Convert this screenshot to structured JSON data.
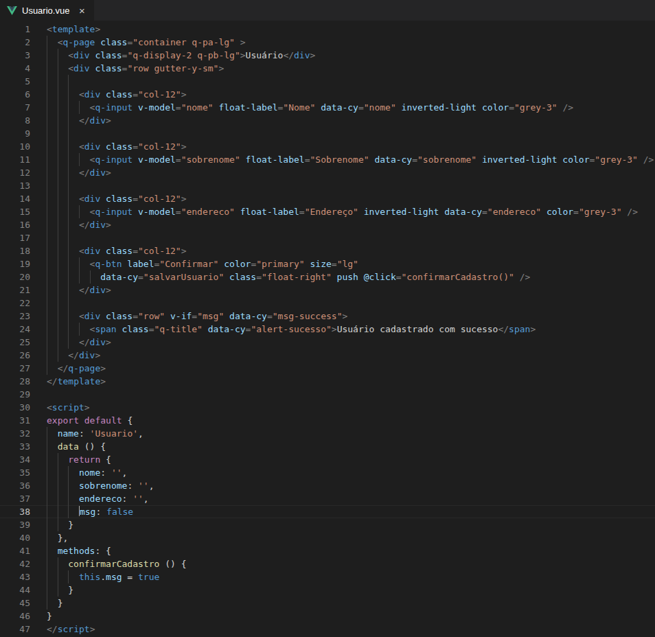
{
  "colors": {
    "editor_bg": "#1e1e1e",
    "tabbar_bg": "#252526",
    "tab_active_bg": "#1e1e1e",
    "tab_title": "#ffffff",
    "tab_close": "#cccccc",
    "line_number": "#858585",
    "line_number_active": "#c6c6c6",
    "indent_guide": "#404040",
    "cursor": "#aeafad",
    "current_line_border": "#282828",
    "tok_punc": "#808080",
    "tok_tag": "#569cd6",
    "tok_attr": "#9cdcfe",
    "tok_string": "#ce9178",
    "tok_text": "#d4d4d4",
    "tok_keyword": "#c586c0",
    "tok_var": "#9cdcfe",
    "tok_func": "#dcdcaa",
    "tok_const": "#569cd6",
    "tok_op": "#d4d4d4",
    "vue_green": "#41b883",
    "vue_dark": "#35495e"
  },
  "tab": {
    "title": "Usuario.vue",
    "close_label": "×"
  },
  "editor": {
    "lines": [
      {
        "n": 1,
        "ind": 0,
        "tokens": [
          [
            "p",
            "<"
          ],
          [
            "t",
            "template"
          ],
          [
            "p",
            ">"
          ]
        ]
      },
      {
        "n": 2,
        "ind": 1,
        "tokens": [
          [
            "p",
            "<"
          ],
          [
            "t",
            "q-page"
          ],
          [
            "a",
            " class"
          ],
          [
            "p",
            "="
          ],
          [
            "s",
            "\"container q-pa-lg\""
          ],
          [
            "p",
            " >"
          ]
        ]
      },
      {
        "n": 3,
        "ind": 2,
        "tokens": [
          [
            "p",
            "<"
          ],
          [
            "t",
            "div"
          ],
          [
            "a",
            " class"
          ],
          [
            "p",
            "="
          ],
          [
            "s",
            "\"q-display-2 q-pb-lg\""
          ],
          [
            "p",
            ">"
          ],
          [
            "x",
            "Usuário"
          ],
          [
            "p",
            "</"
          ],
          [
            "t",
            "div"
          ],
          [
            "p",
            ">"
          ]
        ]
      },
      {
        "n": 4,
        "ind": 2,
        "tokens": [
          [
            "p",
            "<"
          ],
          [
            "t",
            "div"
          ],
          [
            "a",
            " class"
          ],
          [
            "p",
            "="
          ],
          [
            "s",
            "\"row gutter-y-sm\""
          ],
          [
            "p",
            ">"
          ]
        ]
      },
      {
        "n": 5,
        "ind": 3,
        "tokens": []
      },
      {
        "n": 6,
        "ind": 3,
        "tokens": [
          [
            "p",
            "<"
          ],
          [
            "t",
            "div"
          ],
          [
            "a",
            " class"
          ],
          [
            "p",
            "="
          ],
          [
            "s",
            "\"col-12\""
          ],
          [
            "p",
            ">"
          ]
        ]
      },
      {
        "n": 7,
        "ind": 4,
        "tokens": [
          [
            "p",
            "<"
          ],
          [
            "t",
            "q-input"
          ],
          [
            "a",
            " v-model"
          ],
          [
            "p",
            "="
          ],
          [
            "s",
            "\"nome\""
          ],
          [
            "a",
            " float-label"
          ],
          [
            "p",
            "="
          ],
          [
            "s",
            "\"Nome\""
          ],
          [
            "a",
            " data-cy"
          ],
          [
            "p",
            "="
          ],
          [
            "s",
            "\"nome\""
          ],
          [
            "a",
            " inverted-light"
          ],
          [
            "a",
            " color"
          ],
          [
            "p",
            "="
          ],
          [
            "s",
            "\"grey-3\""
          ],
          [
            "p",
            " />"
          ]
        ]
      },
      {
        "n": 8,
        "ind": 3,
        "tokens": [
          [
            "p",
            "</"
          ],
          [
            "t",
            "div"
          ],
          [
            "p",
            ">"
          ]
        ]
      },
      {
        "n": 9,
        "ind": 3,
        "tokens": []
      },
      {
        "n": 10,
        "ind": 3,
        "tokens": [
          [
            "p",
            "<"
          ],
          [
            "t",
            "div"
          ],
          [
            "a",
            " class"
          ],
          [
            "p",
            "="
          ],
          [
            "s",
            "\"col-12\""
          ],
          [
            "p",
            ">"
          ]
        ]
      },
      {
        "n": 11,
        "ind": 4,
        "tokens": [
          [
            "p",
            "<"
          ],
          [
            "t",
            "q-input"
          ],
          [
            "a",
            " v-model"
          ],
          [
            "p",
            "="
          ],
          [
            "s",
            "\"sobrenome\""
          ],
          [
            "a",
            " float-label"
          ],
          [
            "p",
            "="
          ],
          [
            "s",
            "\"Sobrenome\""
          ],
          [
            "a",
            " data-cy"
          ],
          [
            "p",
            "="
          ],
          [
            "s",
            "\"sobrenome\""
          ],
          [
            "a",
            " inverted-light"
          ],
          [
            "a",
            " color"
          ],
          [
            "p",
            "="
          ],
          [
            "s",
            "\"grey-3\""
          ],
          [
            "p",
            " />"
          ]
        ]
      },
      {
        "n": 12,
        "ind": 3,
        "tokens": [
          [
            "p",
            "</"
          ],
          [
            "t",
            "div"
          ],
          [
            "p",
            ">"
          ]
        ]
      },
      {
        "n": 13,
        "ind": 3,
        "tokens": []
      },
      {
        "n": 14,
        "ind": 3,
        "tokens": [
          [
            "p",
            "<"
          ],
          [
            "t",
            "div"
          ],
          [
            "a",
            " class"
          ],
          [
            "p",
            "="
          ],
          [
            "s",
            "\"col-12\""
          ],
          [
            "p",
            ">"
          ]
        ]
      },
      {
        "n": 15,
        "ind": 4,
        "tokens": [
          [
            "p",
            "<"
          ],
          [
            "t",
            "q-input"
          ],
          [
            "a",
            " v-model"
          ],
          [
            "p",
            "="
          ],
          [
            "s",
            "\"endereco\""
          ],
          [
            "a",
            " float-label"
          ],
          [
            "p",
            "="
          ],
          [
            "s",
            "\"Endereço\""
          ],
          [
            "a",
            " inverted-light"
          ],
          [
            "a",
            " data-cy"
          ],
          [
            "p",
            "="
          ],
          [
            "s",
            "\"endereco\""
          ],
          [
            "a",
            " color"
          ],
          [
            "p",
            "="
          ],
          [
            "s",
            "\"grey-3\""
          ],
          [
            "p",
            " />"
          ]
        ]
      },
      {
        "n": 16,
        "ind": 3,
        "tokens": [
          [
            "p",
            "</"
          ],
          [
            "t",
            "div"
          ],
          [
            "p",
            ">"
          ]
        ]
      },
      {
        "n": 17,
        "ind": 3,
        "tokens": []
      },
      {
        "n": 18,
        "ind": 3,
        "tokens": [
          [
            "p",
            "<"
          ],
          [
            "t",
            "div"
          ],
          [
            "a",
            " class"
          ],
          [
            "p",
            "="
          ],
          [
            "s",
            "\"col-12\""
          ],
          [
            "p",
            ">"
          ]
        ]
      },
      {
        "n": 19,
        "ind": 4,
        "tokens": [
          [
            "p",
            "<"
          ],
          [
            "t",
            "q-btn"
          ],
          [
            "a",
            " label"
          ],
          [
            "p",
            "="
          ],
          [
            "s",
            "\"Confirmar\""
          ],
          [
            "a",
            " color"
          ],
          [
            "p",
            "="
          ],
          [
            "s",
            "\"primary\""
          ],
          [
            "a",
            " size"
          ],
          [
            "p",
            "="
          ],
          [
            "s",
            "\"lg\""
          ]
        ]
      },
      {
        "n": 20,
        "ind": 5,
        "tokens": [
          [
            "a",
            "data-cy"
          ],
          [
            "p",
            "="
          ],
          [
            "s",
            "\"salvarUsuario\""
          ],
          [
            "a",
            " class"
          ],
          [
            "p",
            "="
          ],
          [
            "s",
            "\"float-right\""
          ],
          [
            "a",
            " push"
          ],
          [
            "a",
            " @click"
          ],
          [
            "p",
            "="
          ],
          [
            "s",
            "\"confirmarCadastro()\""
          ],
          [
            "p",
            " />"
          ]
        ]
      },
      {
        "n": 21,
        "ind": 3,
        "tokens": [
          [
            "p",
            "</"
          ],
          [
            "t",
            "div"
          ],
          [
            "p",
            ">"
          ]
        ]
      },
      {
        "n": 22,
        "ind": 3,
        "tokens": []
      },
      {
        "n": 23,
        "ind": 3,
        "tokens": [
          [
            "p",
            "<"
          ],
          [
            "t",
            "div"
          ],
          [
            "a",
            " class"
          ],
          [
            "p",
            "="
          ],
          [
            "s",
            "\"row\""
          ],
          [
            "a",
            " v-if"
          ],
          [
            "p",
            "="
          ],
          [
            "s",
            "\"msg\""
          ],
          [
            "a",
            " data-cy"
          ],
          [
            "p",
            "="
          ],
          [
            "s",
            "\"msg-success\""
          ],
          [
            "p",
            ">"
          ]
        ]
      },
      {
        "n": 24,
        "ind": 4,
        "tokens": [
          [
            "p",
            "<"
          ],
          [
            "t",
            "span"
          ],
          [
            "a",
            " class"
          ],
          [
            "p",
            "="
          ],
          [
            "s",
            "\"q-title\""
          ],
          [
            "a",
            " data-cy"
          ],
          [
            "p",
            "="
          ],
          [
            "s",
            "\"alert-sucesso\""
          ],
          [
            "p",
            ">"
          ],
          [
            "x",
            "Usuário cadastrado com sucesso"
          ],
          [
            "p",
            "</"
          ],
          [
            "t",
            "span"
          ],
          [
            "p",
            ">"
          ]
        ]
      },
      {
        "n": 25,
        "ind": 3,
        "tokens": [
          [
            "p",
            "</"
          ],
          [
            "t",
            "div"
          ],
          [
            "p",
            ">"
          ]
        ]
      },
      {
        "n": 26,
        "ind": 2,
        "tokens": [
          [
            "p",
            "</"
          ],
          [
            "t",
            "div"
          ],
          [
            "p",
            ">"
          ]
        ]
      },
      {
        "n": 27,
        "ind": 1,
        "tokens": [
          [
            "p",
            "</"
          ],
          [
            "t",
            "q-page"
          ],
          [
            "p",
            ">"
          ]
        ]
      },
      {
        "n": 28,
        "ind": 0,
        "tokens": [
          [
            "p",
            "</"
          ],
          [
            "t",
            "template"
          ],
          [
            "p",
            ">"
          ]
        ]
      },
      {
        "n": 29,
        "ind": 0,
        "tokens": []
      },
      {
        "n": 30,
        "ind": 0,
        "tokens": [
          [
            "p",
            "<"
          ],
          [
            "t",
            "script"
          ],
          [
            "p",
            ">"
          ]
        ]
      },
      {
        "n": 31,
        "ind": 0,
        "tokens": [
          [
            "k",
            "export default"
          ],
          [
            "o",
            " {"
          ]
        ]
      },
      {
        "n": 32,
        "ind": 1,
        "tokens": [
          [
            "v",
            "name"
          ],
          [
            "o",
            ": "
          ],
          [
            "s",
            "'Usuario'"
          ],
          [
            "o",
            ","
          ]
        ]
      },
      {
        "n": 33,
        "ind": 1,
        "tokens": [
          [
            "f",
            "data"
          ],
          [
            "o",
            " () {"
          ]
        ]
      },
      {
        "n": 34,
        "ind": 2,
        "tokens": [
          [
            "k",
            "return"
          ],
          [
            "o",
            " {"
          ]
        ]
      },
      {
        "n": 35,
        "ind": 3,
        "tokens": [
          [
            "v",
            "nome"
          ],
          [
            "o",
            ": "
          ],
          [
            "s",
            "''"
          ],
          [
            "o",
            ","
          ]
        ]
      },
      {
        "n": 36,
        "ind": 3,
        "tokens": [
          [
            "v",
            "sobrenome"
          ],
          [
            "o",
            ": "
          ],
          [
            "s",
            "''"
          ],
          [
            "o",
            ","
          ]
        ]
      },
      {
        "n": 37,
        "ind": 3,
        "tokens": [
          [
            "v",
            "endereco"
          ],
          [
            "o",
            ": "
          ],
          [
            "s",
            "''"
          ],
          [
            "o",
            ","
          ]
        ]
      },
      {
        "n": 38,
        "ind": 3,
        "active": true,
        "cursor": true,
        "tokens": [
          [
            "v",
            "msg"
          ],
          [
            "o",
            ": "
          ],
          [
            "c",
            "false"
          ]
        ]
      },
      {
        "n": 39,
        "ind": 2,
        "tokens": [
          [
            "o",
            "}"
          ]
        ]
      },
      {
        "n": 40,
        "ind": 1,
        "tokens": [
          [
            "o",
            "},"
          ]
        ]
      },
      {
        "n": 41,
        "ind": 1,
        "tokens": [
          [
            "v",
            "methods"
          ],
          [
            "o",
            ": {"
          ]
        ]
      },
      {
        "n": 42,
        "ind": 2,
        "tokens": [
          [
            "f",
            "confirmarCadastro"
          ],
          [
            "o",
            " () {"
          ]
        ]
      },
      {
        "n": 43,
        "ind": 3,
        "tokens": [
          [
            "c",
            "this"
          ],
          [
            "o",
            "."
          ],
          [
            "v",
            "msg"
          ],
          [
            "o",
            " = "
          ],
          [
            "c",
            "true"
          ]
        ]
      },
      {
        "n": 44,
        "ind": 2,
        "tokens": [
          [
            "o",
            "}"
          ]
        ]
      },
      {
        "n": 45,
        "ind": 1,
        "tokens": [
          [
            "o",
            "}"
          ]
        ]
      },
      {
        "n": 46,
        "ind": 0,
        "tokens": [
          [
            "o",
            "}"
          ]
        ]
      },
      {
        "n": 47,
        "ind": 0,
        "tokens": [
          [
            "p",
            "</"
          ],
          [
            "t",
            "script"
          ],
          [
            "p",
            ">"
          ]
        ]
      }
    ]
  }
}
